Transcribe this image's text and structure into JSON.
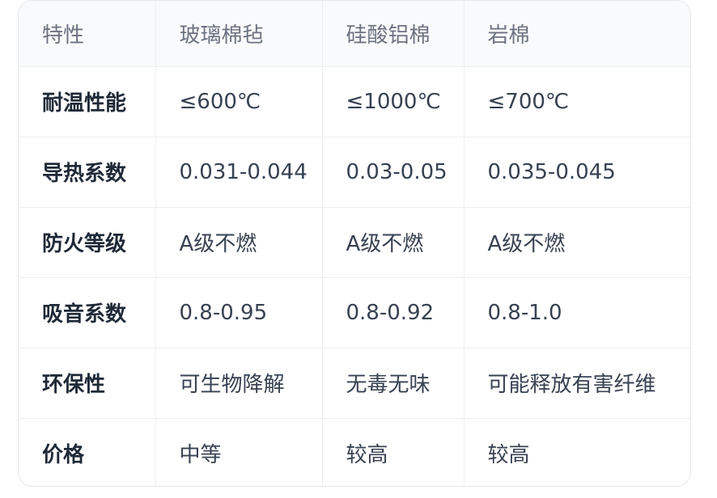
{
  "table": {
    "headers": [
      "特性",
      "玻璃棉毡",
      "硅酸铝棉",
      "岩棉"
    ],
    "rows": [
      [
        "耐温性能",
        "≤600℃",
        "≤1000℃",
        "≤700℃"
      ],
      [
        "导热系数",
        "0.031-0.044",
        "0.03-0.05",
        "0.035-0.045"
      ],
      [
        "防火等级",
        "A级不燃",
        "A级不燃",
        "A级不燃"
      ],
      [
        "吸音系数",
        "0.8-0.95",
        "0.8-0.92",
        "0.8-1.0"
      ],
      [
        "环保性",
        "可生物降解",
        "无毒无味",
        "可能释放有害纤维"
      ],
      [
        "价格",
        "中等",
        "较高",
        "较高"
      ]
    ]
  }
}
